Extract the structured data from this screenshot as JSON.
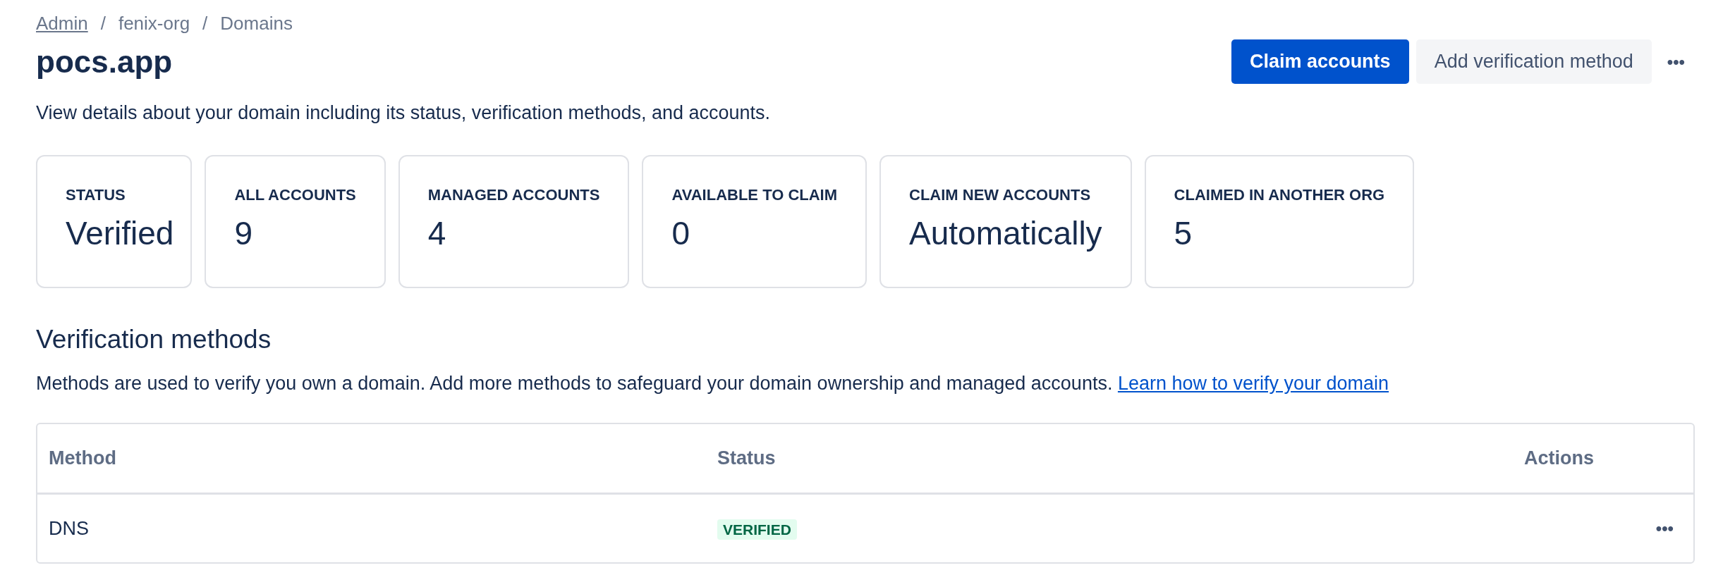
{
  "breadcrumbs": [
    {
      "label": "Admin",
      "kind": "link"
    },
    {
      "label": "fenix-org",
      "kind": "text"
    },
    {
      "label": "Domains",
      "kind": "text"
    }
  ],
  "breadcrumb_separator": "/",
  "title": "pocs.app",
  "actions": [
    {
      "label": "Claim accounts",
      "kind": "primary"
    },
    {
      "label": "Add verification method",
      "kind": "secondary"
    },
    {
      "label": "•••",
      "kind": "more"
    }
  ],
  "description": "View details about your domain including its status, verification methods, and accounts.",
  "stats": [
    {
      "label": "STATUS",
      "value": "Verified"
    },
    {
      "label": "ALL ACCOUNTS",
      "value": "9"
    },
    {
      "label": "MANAGED ACCOUNTS",
      "value": "4"
    },
    {
      "label": "AVAILABLE TO CLAIM",
      "value": "0"
    },
    {
      "label": "CLAIM NEW ACCOUNTS",
      "value": "Automatically"
    },
    {
      "label": "CLAIMED IN ANOTHER ORG",
      "value": "5"
    }
  ],
  "verification": {
    "heading": "Verification methods",
    "text": "Methods are used to verify you own a domain. Add more methods to safeguard your domain ownership and managed accounts.",
    "link": "Learn how to verify your domain",
    "table": {
      "columns": [
        "Method",
        "Status",
        "Actions"
      ],
      "rows": [
        {
          "method": "DNS",
          "status": "VERIFIED",
          "actions": "•••"
        }
      ]
    }
  }
}
